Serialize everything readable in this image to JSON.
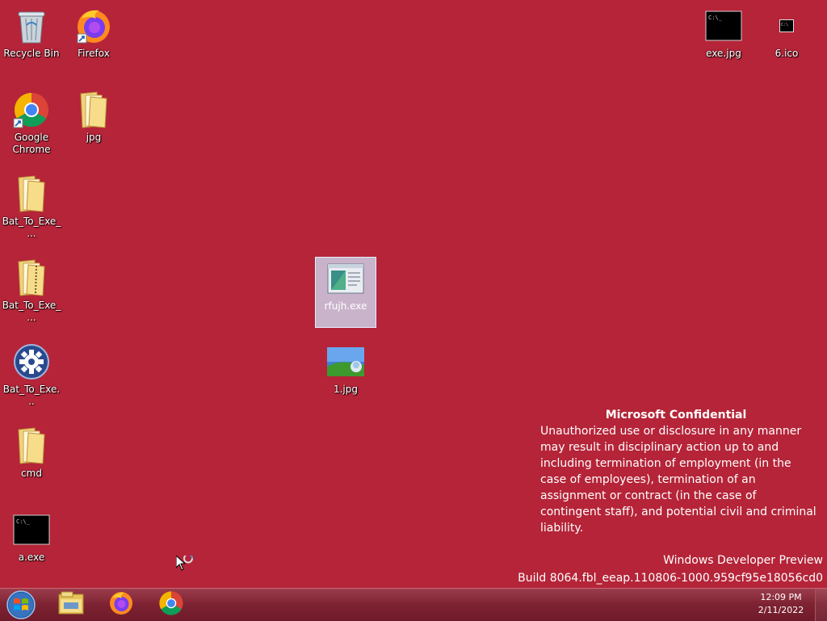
{
  "desktop": {
    "icons": [
      {
        "label": "Recycle Bin",
        "icon": "recycle-bin-icon"
      },
      {
        "label": "Firefox",
        "icon": "firefox-icon"
      },
      {
        "label": "exe.jpg",
        "icon": "console-image-icon"
      },
      {
        "label": "6.ico",
        "icon": "console-small-icon"
      },
      {
        "label": "Google Chrome",
        "icon": "chrome-icon"
      },
      {
        "label": "jpg",
        "icon": "folder-icon"
      },
      {
        "label": "Bat_To_Exe_...",
        "icon": "folder-icon"
      },
      {
        "label": "rfujh.exe",
        "icon": "exe-icon"
      },
      {
        "label": "Bat_To_Exe_...",
        "icon": "zip-folder-icon"
      },
      {
        "label": "Bat_To_Exe...",
        "icon": "gear-icon"
      },
      {
        "label": "1.jpg",
        "icon": "image-icon"
      },
      {
        "label": "cmd",
        "icon": "folder-icon"
      },
      {
        "label": "a.exe",
        "icon": "console-icon"
      }
    ],
    "selected_icon": "rfujh.exe"
  },
  "watermark": {
    "title": "Microsoft Confidential",
    "body": "Unauthorized use or disclosure in any manner may result in disciplinary action up to and including termination of employment (in the case of employees), termination of an assignment or contract (in the case of contingent staff), and potential civil and criminal liability.",
    "edition": "Windows Developer Preview",
    "build": "Build 8064.fbl_eeap.110806-1000.959cf95e18056cd0"
  },
  "taskbar": {
    "start": "start-orb-icon",
    "pinned": [
      "file-explorer-icon",
      "firefox-icon",
      "chrome-icon"
    ],
    "clock": {
      "time": "12:09 PM",
      "date": "2/11/2022"
    }
  },
  "colors": {
    "desktop": "#b52438",
    "taskbar": "#7d2232"
  }
}
